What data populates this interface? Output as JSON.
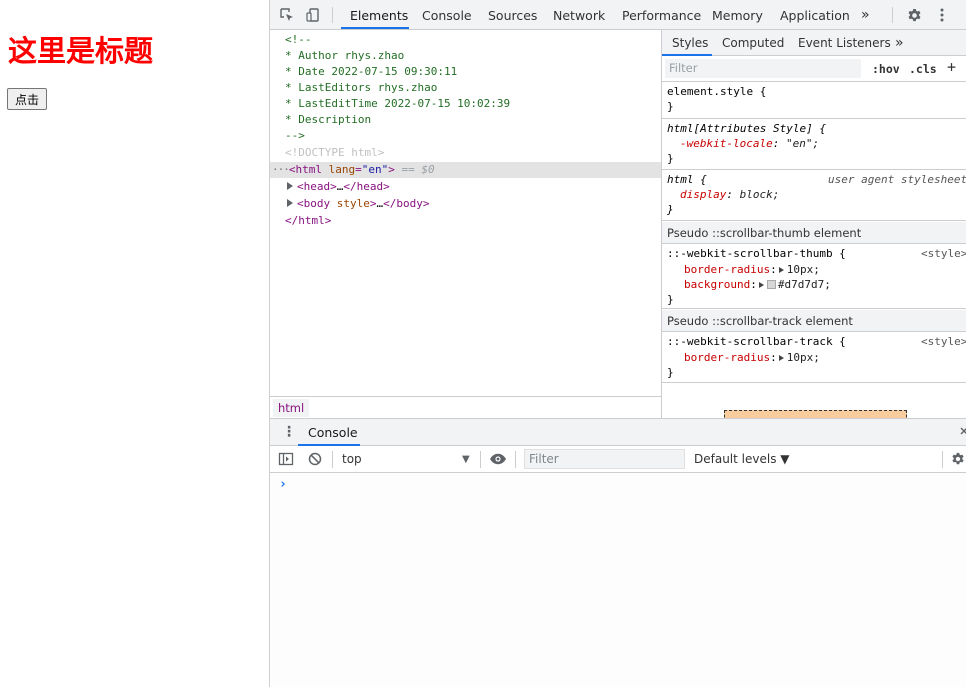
{
  "page": {
    "title": "这里是标题",
    "button_label": "点击"
  },
  "devtools": {
    "top_tabs": [
      "Elements",
      "Console",
      "Sources",
      "Network",
      "Performance",
      "Memory",
      "Application"
    ],
    "more_tabs_glyph": "»",
    "elements_tree": {
      "comment_lines": [
        "<!--",
        " * Author  rhys.zhao",
        " * Date  2022-07-15 09:30:11",
        " * LastEditors  rhys.zhao",
        " * LastEditTime  2022-07-15 10:02:39",
        " * Description",
        "-->"
      ],
      "doctype": "<!DOCTYPE html>",
      "html_open_tag": "html",
      "html_attr_name": "lang",
      "html_attr_value": "\"en\"",
      "selected_marker": "== $0",
      "head_tag": "head",
      "body_tag": "body",
      "body_attr": "style",
      "ellipsis": "…",
      "html_close": "</html>"
    },
    "breadcrumb": "html",
    "styles_pane": {
      "sub_tabs": [
        "Styles",
        "Computed",
        "Event Listeners"
      ],
      "more_glyph": "»",
      "filter_placeholder": "Filter",
      "hov_label": ":hov",
      "cls_label": ".cls",
      "add_glyph": "+",
      "rules": {
        "element_style": "element.style {",
        "close_brace": "}",
        "attr_style_selector": "html[Attributes Style] {",
        "locale_prop": "-webkit-locale",
        "locale_val": "\"en\";",
        "html_selector": "html {",
        "ua_origin": "user agent stylesheet",
        "display_prop": "display",
        "display_val": "block;"
      },
      "pseudo_thumb": {
        "header": "Pseudo ::scrollbar-thumb element",
        "selector": "::-webkit-scrollbar-thumb {",
        "origin": "<style>",
        "radius_prop": "border-radius",
        "radius_val": "10px;",
        "bg_prop": "background",
        "bg_val": "#d7d7d7;",
        "swatch_color": "#d7d7d7"
      },
      "pseudo_track": {
        "header": "Pseudo ::scrollbar-track element",
        "selector": "::-webkit-scrollbar-track {",
        "origin": "<style>",
        "radius_prop": "border-radius",
        "radius_val": "10px;"
      }
    },
    "drawer": {
      "tab": "Console"
    },
    "console_toolbar": {
      "context": "top",
      "filter_placeholder": "Filter",
      "levels": "Default levels ▼"
    },
    "console": {
      "prompt": "›"
    }
  }
}
